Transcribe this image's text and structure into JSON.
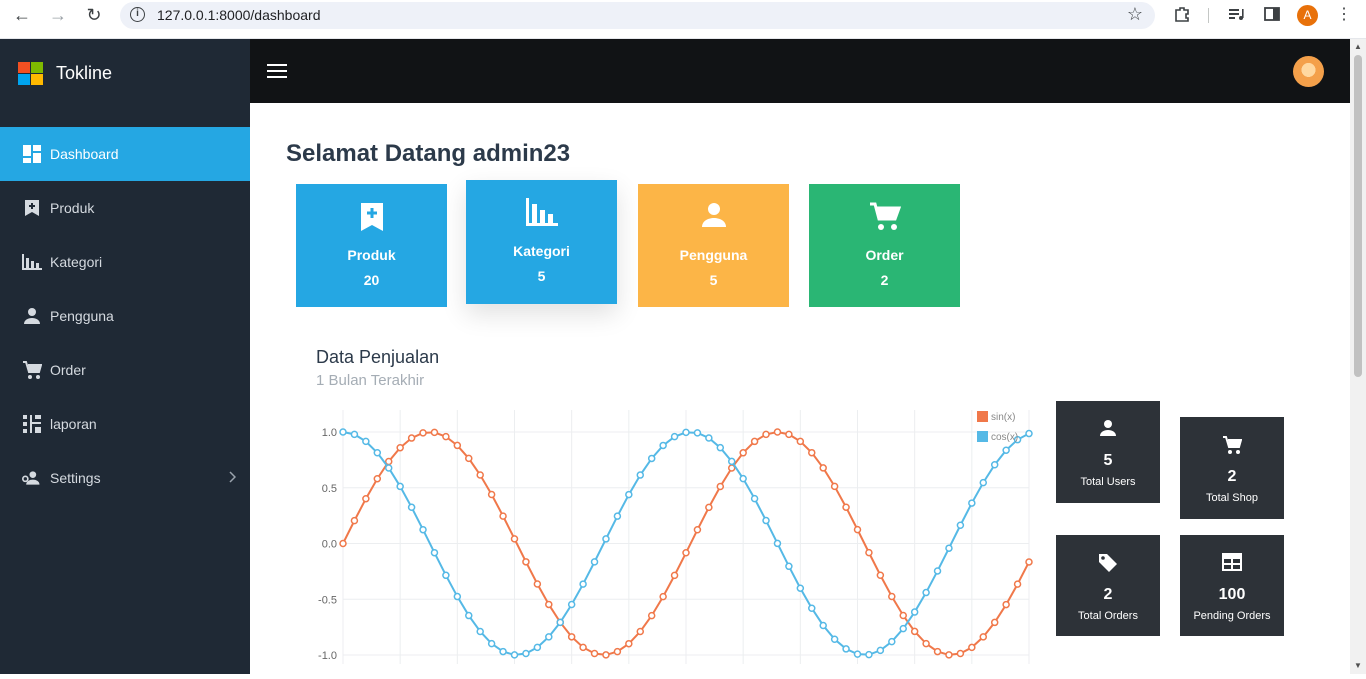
{
  "browser": {
    "url": "127.0.0.1:8000/dashboard",
    "profile_initial": "A"
  },
  "sidebar": {
    "brand": "Tokline",
    "items": [
      {
        "label": "Dashboard",
        "icon": "dashboard-icon",
        "active": true
      },
      {
        "label": "Produk",
        "icon": "bookmark-add-icon"
      },
      {
        "label": "Kategori",
        "icon": "bar-chart-icon"
      },
      {
        "label": "Pengguna",
        "icon": "person-icon"
      },
      {
        "label": "Order",
        "icon": "cart-icon"
      },
      {
        "label": "laporan",
        "icon": "report-icon"
      },
      {
        "label": "Settings",
        "icon": "users-settings-icon",
        "has_submenu": true
      }
    ]
  },
  "main": {
    "welcome": "Selamat Datang admin23",
    "cards": [
      {
        "label": "Produk",
        "value": "20",
        "color": "#25a7e3",
        "icon": "bookmark-add-icon"
      },
      {
        "label": "Kategori",
        "value": "5",
        "color": "#25a7e3",
        "icon": "bar-chart-icon"
      },
      {
        "label": "Pengguna",
        "value": "5",
        "color": "#fcb547",
        "icon": "person-icon"
      },
      {
        "label": "Order",
        "value": "2",
        "color": "#2ab674",
        "icon": "cart-icon"
      }
    ],
    "chart_title": "Data Penjualan",
    "chart_subtitle": "1 Bulan Terakhir",
    "stats": [
      {
        "label": "Total Users",
        "value": "5",
        "icon": "person-icon"
      },
      {
        "label": "Total Shop",
        "value": "2",
        "icon": "cart-icon"
      },
      {
        "label": "Total Orders",
        "value": "2",
        "icon": "tag-icon"
      },
      {
        "label": "Pending Orders",
        "value": "100",
        "icon": "table-icon"
      }
    ]
  },
  "chart_data": {
    "type": "line",
    "x_range": [
      0,
      12.4
    ],
    "ylim": [
      -1.0,
      1.0
    ],
    "y_ticks": [
      "1.0",
      "0.5",
      "0.0",
      "-0.5",
      "-1.0"
    ],
    "grid": true,
    "legend": "top-right",
    "series": [
      {
        "name": "sin(x)",
        "color": "#f0784a",
        "function": "sin"
      },
      {
        "name": "cos(x)",
        "color": "#55b9e6",
        "function": "cos"
      }
    ]
  },
  "colors": {
    "sidebar_bg": "#1f2935",
    "topbar_bg": "#111315",
    "accent": "#25a7e3",
    "stat_bg": "#2d3238"
  }
}
